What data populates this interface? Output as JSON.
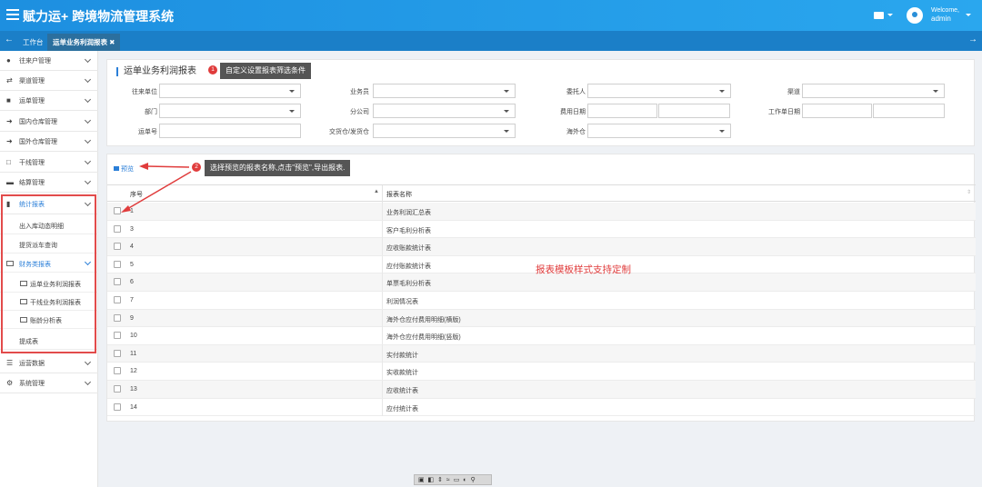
{
  "header": {
    "app_title": "赋力运+ 跨境物流管理系统",
    "welcome": "Welcome,",
    "username": "admin"
  },
  "tabs": {
    "home": "工作台",
    "active": "运单业务利润报表 ✖"
  },
  "sidebar": {
    "items": [
      {
        "label": "往来户管理"
      },
      {
        "label": "渠道管理"
      },
      {
        "label": "运单管理"
      },
      {
        "label": "国内仓库管理"
      },
      {
        "label": "国外仓库管理"
      },
      {
        "label": "干线管理"
      },
      {
        "label": "结算管理"
      },
      {
        "label": "统计报表"
      },
      {
        "label": "运营数据"
      },
      {
        "label": "系统管理"
      }
    ],
    "stats_sub": [
      "出入库动态明细",
      "提货派车查询"
    ],
    "finance": "财务类报表",
    "finance_sub": [
      "运单业务利润报表",
      "干线业务利润报表",
      "账龄分析表"
    ],
    "commission": "提成表"
  },
  "filter": {
    "title": "运单业务利润报表",
    "labels": {
      "counterparty": "往来单位",
      "salesperson": "业务员",
      "consignor": "委托人",
      "channel": "渠道",
      "department": "部门",
      "branch": "分公司",
      "fee_date": "费用日期",
      "work_date": "工作单日期",
      "waybill": "运单号",
      "warehouse": "交货仓/发货仓",
      "overseas": "海外仓"
    }
  },
  "annotations": {
    "a1_num": "1",
    "a1_text": "自定义设置报表筛选条件",
    "a2_num": "2",
    "a2_text": "选择预览的报表名称,点击\"预览\",导出报表.",
    "custom_note": "报表模板样式支持定制"
  },
  "list": {
    "preview_label": "预览",
    "col_index": "序号",
    "col_name": "报表名称",
    "rows": [
      {
        "idx": "1",
        "name": "业务利润汇总表"
      },
      {
        "idx": "3",
        "name": "客户毛利分析表"
      },
      {
        "idx": "4",
        "name": "应收账款统计表"
      },
      {
        "idx": "5",
        "name": "应付账款统计表"
      },
      {
        "idx": "6",
        "name": "单票毛利分析表"
      },
      {
        "idx": "7",
        "name": "利润情况表"
      },
      {
        "idx": "9",
        "name": "海外仓应付费用明细(横版)"
      },
      {
        "idx": "10",
        "name": "海外仓应付费用明细(竖版)"
      },
      {
        "idx": "11",
        "name": "实付款统计"
      },
      {
        "idx": "12",
        "name": "实收款统计"
      },
      {
        "idx": "13",
        "name": "应收统计表"
      },
      {
        "idx": "14",
        "name": "应付统计表"
      }
    ]
  },
  "colors": {
    "accent": "#2b7fd8",
    "header": "#1d8fe0",
    "annotation_red": "#e03c3c"
  }
}
